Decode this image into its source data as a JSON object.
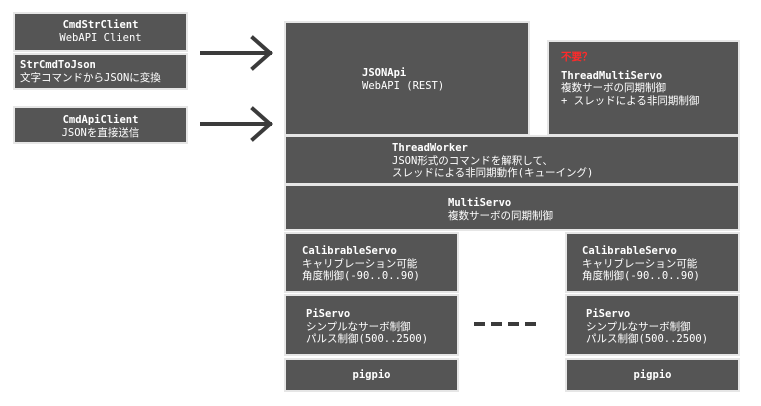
{
  "clients": {
    "cmdstr": {
      "title": "CmdStrClient",
      "sub": "WebAPI Client"
    },
    "strcmd": {
      "title": "StrCmdToJson",
      "sub": "文字コマンドからJSONに変換"
    },
    "cmdapi": {
      "title": "CmdApiClient",
      "sub": "JSONを直接送信"
    }
  },
  "jsonapi": {
    "title": "JSONApi",
    "sub": "WebAPI (REST)"
  },
  "thread_multi_servo": {
    "note": "不要？",
    "title": "ThreadMultiServo",
    "line1": "複数サーボの同期制御",
    "line2": "+ スレッドによる非同期制御"
  },
  "thread_worker": {
    "title": "ThreadWorker",
    "line1": "JSON形式のコマンドを解釈して、",
    "line2": "スレッドによる非同期動作(キューイング)"
  },
  "multi_servo": {
    "title": "MultiServo",
    "sub": "複数サーボの同期制御"
  },
  "stack_left": {
    "calib": {
      "title": "CalibrableServo",
      "line1": "キャリブレーション可能",
      "line2": "角度制御(-90..0..90)"
    },
    "pi": {
      "title": "PiServo",
      "line1": "シンプルなサーボ制御",
      "line2": "パルス制御(500..2500)"
    },
    "pigpio": "pigpio"
  },
  "stack_right": {
    "calib": {
      "title": "CalibrableServo",
      "line1": "キャリブレーション可能",
      "line2": "角度制御(-90..0..90)"
    },
    "pi": {
      "title": "PiServo",
      "line1": "シンプルなサーボ制御",
      "line2": "パルス制御(500..2500)"
    },
    "pigpio": "pigpio"
  },
  "colors": {
    "box_fill": "#555555",
    "box_border": "#e6e6e6",
    "text": "#ffffff",
    "note": "#ff2a2a",
    "arrow": "#3b3b3b"
  }
}
